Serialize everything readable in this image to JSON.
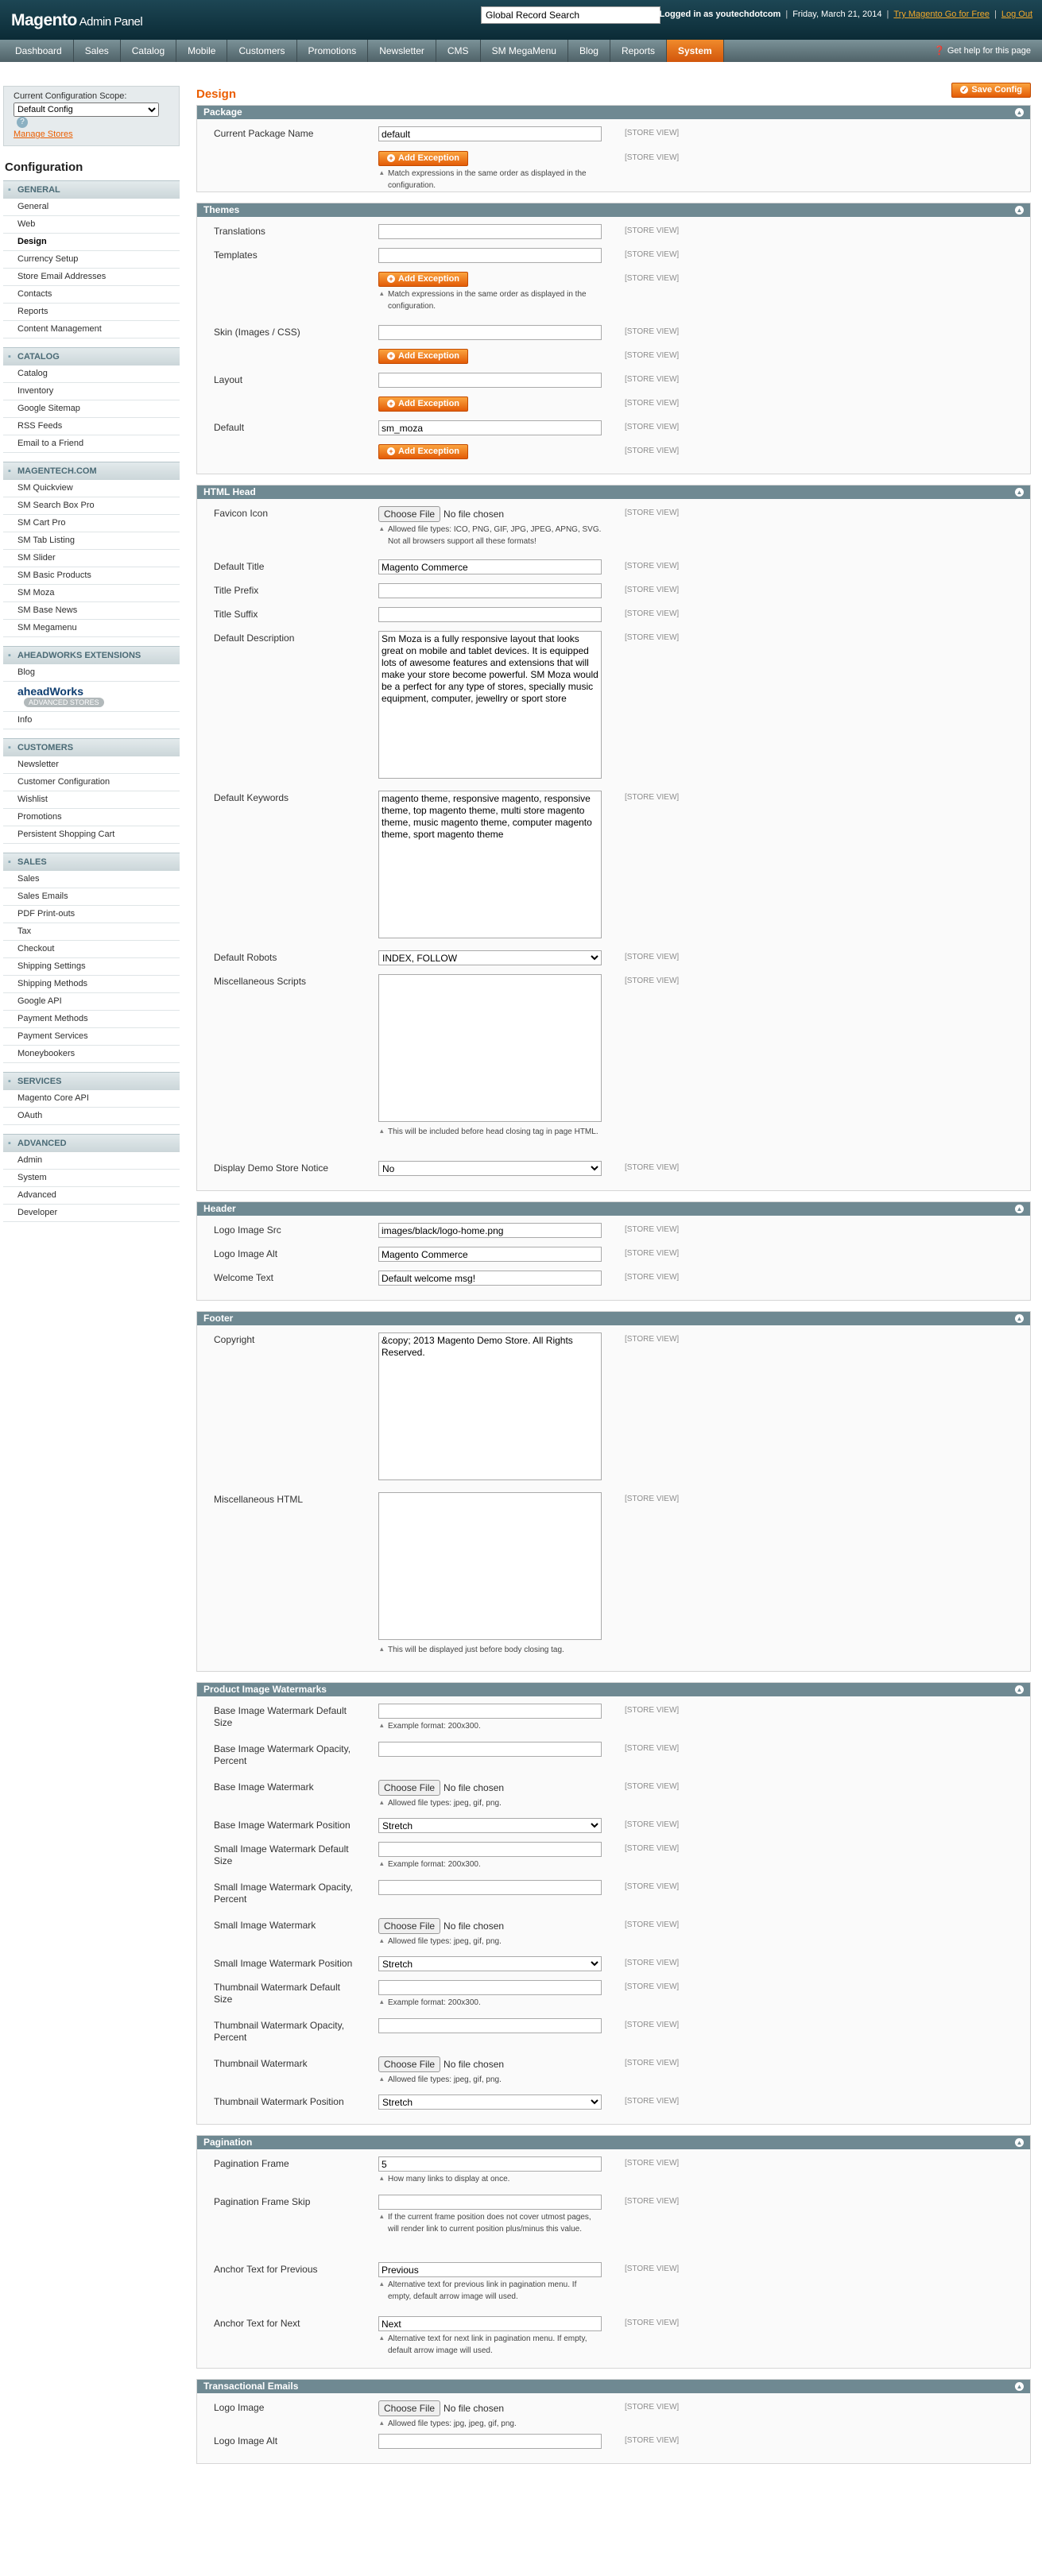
{
  "header": {
    "logo_brand": "Magento",
    "logo_sub": "Admin Panel",
    "search_value": "Global Record Search",
    "logged_in": "Logged in as youtechdotcom",
    "date": "Friday, March 21, 2014",
    "try_go": "Try Magento Go for Free",
    "logout": "Log Out"
  },
  "nav": {
    "items": [
      "Dashboard",
      "Sales",
      "Catalog",
      "Mobile",
      "Customers",
      "Promotions",
      "Newsletter",
      "CMS",
      "SM MegaMenu",
      "Blog",
      "Reports",
      "System"
    ],
    "active": "System",
    "help": "Get help for this page"
  },
  "sidebar": {
    "scope_label": "Current Configuration Scope:",
    "scope_value": "Default Config",
    "manage_stores": "Manage Stores",
    "title": "Configuration",
    "sections": [
      {
        "title": "GENERAL",
        "items": [
          "General",
          "Web",
          "Design",
          "Currency Setup",
          "Store Email Addresses",
          "Contacts",
          "Reports",
          "Content Management"
        ]
      },
      {
        "title": "CATALOG",
        "items": [
          "Catalog",
          "Inventory",
          "Google Sitemap",
          "RSS Feeds",
          "Email to a Friend"
        ]
      },
      {
        "title": "MAGENTECH.COM",
        "items": [
          "SM Quickview",
          "SM Search Box Pro",
          "SM Cart Pro",
          "SM Tab Listing",
          "SM Slider",
          "SM Basic Products",
          "SM Moza",
          "SM Base News",
          "SM Megamenu"
        ]
      },
      {
        "title": "AHEADWORKS EXTENSIONS",
        "items": [
          "Blog",
          "aheadWorks",
          "Info"
        ]
      },
      {
        "title": "CUSTOMERS",
        "items": [
          "Newsletter",
          "Customer Configuration",
          "Wishlist",
          "Promotions",
          "Persistent Shopping Cart"
        ]
      },
      {
        "title": "SALES",
        "items": [
          "Sales",
          "Sales Emails",
          "PDF Print-outs",
          "Tax",
          "Checkout",
          "Shipping Settings",
          "Shipping Methods",
          "Google API",
          "Payment Methods",
          "Payment Services",
          "Moneybookers"
        ]
      },
      {
        "title": "SERVICES",
        "items": [
          "Magento Core API",
          "OAuth"
        ]
      },
      {
        "title": "ADVANCED",
        "items": [
          "Admin",
          "System",
          "Advanced",
          "Developer"
        ]
      }
    ],
    "aw_badge": "ADVANCED STORES"
  },
  "main": {
    "title": "Design",
    "save_label": "Save Config",
    "scope_text": "[STORE VIEW]",
    "add_exception": "Add Exception",
    "match_note": "Match expressions in the same order as displayed in the configuration.",
    "choose_file": "Choose File",
    "no_file": "No file chosen",
    "package": {
      "title": "Package",
      "current_label": "Current Package Name",
      "current_value": "default"
    },
    "themes": {
      "title": "Themes",
      "translations": "Translations",
      "templates": "Templates",
      "skin": "Skin (Images / CSS)",
      "layout": "Layout",
      "default_label": "Default",
      "default_value": "sm_moza"
    },
    "html_head": {
      "title": "HTML Head",
      "favicon": "Favicon Icon",
      "favicon_note": "Allowed file types: ICO, PNG, GIF, JPG, JPEG, APNG, SVG. Not all browsers support all these formats!",
      "default_title": "Default Title",
      "default_title_value": "Magento Commerce",
      "title_prefix": "Title Prefix",
      "title_suffix": "Title Suffix",
      "default_desc": "Default Description",
      "default_desc_value": "Sm Moza is a fully responsive layout that looks great on mobile and tablet devices. It is equipped lots of awesome features and extensions that will make your store become powerful. SM Moza would be a perfect for any type of stores, specially music equipment, computer, jewellry or sport store",
      "default_keywords": "Default Keywords",
      "default_keywords_value": "magento theme, responsive magento, responsive theme, top magento theme, multi store magento theme, music magento theme, computer magento theme, sport magento theme",
      "default_robots": "Default Robots",
      "default_robots_value": "INDEX, FOLLOW",
      "misc_scripts": "Miscellaneous Scripts",
      "misc_scripts_note": "This will be included before head closing tag in page HTML.",
      "demo_notice": "Display Demo Store Notice",
      "demo_notice_value": "No"
    },
    "header_sec": {
      "title": "Header",
      "logo_src": "Logo Image Src",
      "logo_src_value": "images/black/logo-home.png",
      "logo_alt": "Logo Image Alt",
      "logo_alt_value": "Magento Commerce",
      "welcome": "Welcome Text",
      "welcome_value": "Default welcome msg!"
    },
    "footer": {
      "title": "Footer",
      "copyright": "Copyright",
      "copyright_value": "&copy; 2013 Magento Demo Store. All Rights Reserved.",
      "misc_html": "Miscellaneous HTML",
      "misc_html_note": "This will be displayed just before body closing tag."
    },
    "watermarks": {
      "title": "Product Image Watermarks",
      "base_size": "Base Image Watermark Default Size",
      "size_note": "Example format: 200x300.",
      "base_opacity": "Base Image Watermark Opacity, Percent",
      "base_image": "Base Image Watermark",
      "type_note": "Allowed file types: jpeg, gif, png.",
      "base_position": "Base Image Watermark Position",
      "stretch": "Stretch",
      "small_size": "Small Image Watermark Default Size",
      "small_opacity": "Small Image Watermark Opacity, Percent",
      "small_image": "Small Image Watermark",
      "small_position": "Small Image Watermark Position",
      "thumb_size": "Thumbnail Watermark Default Size",
      "thumb_opacity": "Thumbnail Watermark Opacity, Percent",
      "thumb_image": "Thumbnail Watermark",
      "thumb_position": "Thumbnail Watermark Position"
    },
    "pagination": {
      "title": "Pagination",
      "frame": "Pagination Frame",
      "frame_value": "5",
      "frame_note": "How many links to display at once.",
      "frame_skip": "Pagination Frame Skip",
      "frame_skip_note": "If the current frame position does not cover utmost pages, will render link to current position plus/minus this value.",
      "anchor_prev": "Anchor Text for Previous",
      "anchor_prev_value": "Previous",
      "anchor_prev_note": "Alternative text for previous link in pagination menu. If empty, default arrow image will used.",
      "anchor_next": "Anchor Text for Next",
      "anchor_next_value": "Next",
      "anchor_next_note": "Alternative text for next link in pagination menu. If empty, default arrow image will used."
    },
    "transactional": {
      "title": "Transactional Emails",
      "logo_image": "Logo Image",
      "logo_note": "Allowed file types: jpg, jpeg, gif, png.",
      "logo_alt": "Logo Image Alt"
    }
  },
  "colors": {
    "accent": "#eb5e00",
    "section_head": "#6f8992",
    "nav_active": "#e56a14",
    "header_bg": "#0b2b36"
  }
}
